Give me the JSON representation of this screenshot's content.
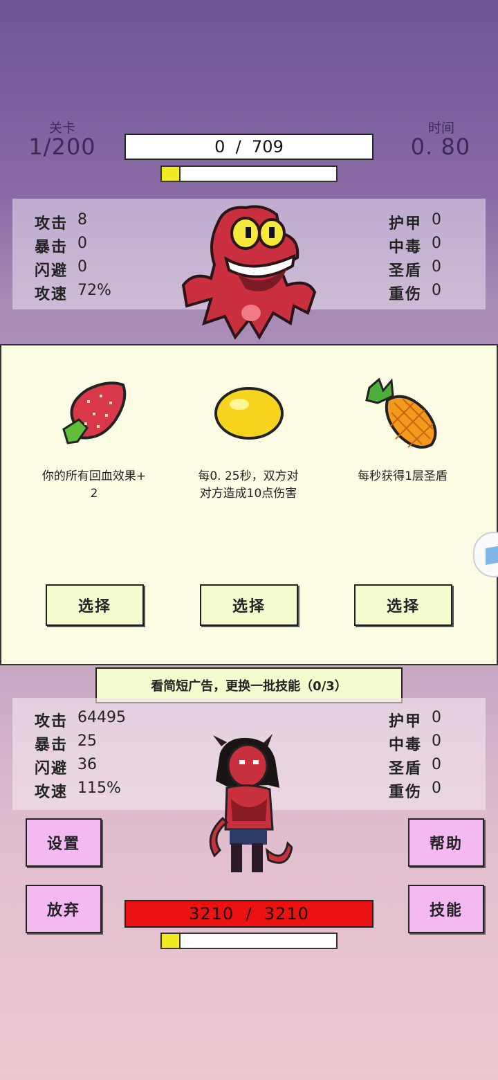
{
  "hud": {
    "level_label": "关卡",
    "level_value": "1/200",
    "time_label": "时间",
    "time_value": "0. 80",
    "enemy_hp_text": "0  /  709",
    "enemy_progress": 0.1
  },
  "enemy_stats": {
    "left": [
      {
        "k": "攻击",
        "v": "8"
      },
      {
        "k": "暴击",
        "v": "0"
      },
      {
        "k": "闪避",
        "v": "0"
      },
      {
        "k": "攻速",
        "v": "72%"
      }
    ],
    "right": [
      {
        "k": "护甲",
        "v": "0"
      },
      {
        "k": "中毒",
        "v": "0"
      },
      {
        "k": "圣盾",
        "v": "0"
      },
      {
        "k": "重伤",
        "v": "0"
      }
    ]
  },
  "choices": [
    {
      "icon": "strawberry-icon",
      "desc_line1": "你的所有回血效果+",
      "desc_line2": "2",
      "button": "选择"
    },
    {
      "icon": "lemon-icon",
      "desc_line1": "每0. 25秒，双方对",
      "desc_line2": "对方造成10点伤害",
      "button": "选择"
    },
    {
      "icon": "pineapple-icon",
      "desc_line1": "每秒获得1层圣盾",
      "desc_line2": "",
      "button": "选择"
    }
  ],
  "ad_refresh_label": "看简短广告，更换一批技能（0/3）",
  "player_stats": {
    "left": [
      {
        "k": "攻击",
        "v": "64495"
      },
      {
        "k": "暴击",
        "v": "25"
      },
      {
        "k": "闪避",
        "v": "36"
      },
      {
        "k": "攻速",
        "v": "115%"
      }
    ],
    "right": [
      {
        "k": "护甲",
        "v": "0"
      },
      {
        "k": "中毒",
        "v": "0"
      },
      {
        "k": "圣盾",
        "v": "0"
      },
      {
        "k": "重伤",
        "v": "0"
      }
    ]
  },
  "buttons": {
    "settings": "设置",
    "help": "帮助",
    "give_up": "放弃",
    "skills": "技能"
  },
  "player_hp_text": "3210  /  3210",
  "player_progress": 0.1,
  "colors": {
    "hp_red": "#ee1111",
    "progress_yellow": "#f2ea22",
    "card_bg": "#fcfbe4",
    "button_green": "#f5fbcf",
    "button_pink": "#f5b9f2"
  }
}
